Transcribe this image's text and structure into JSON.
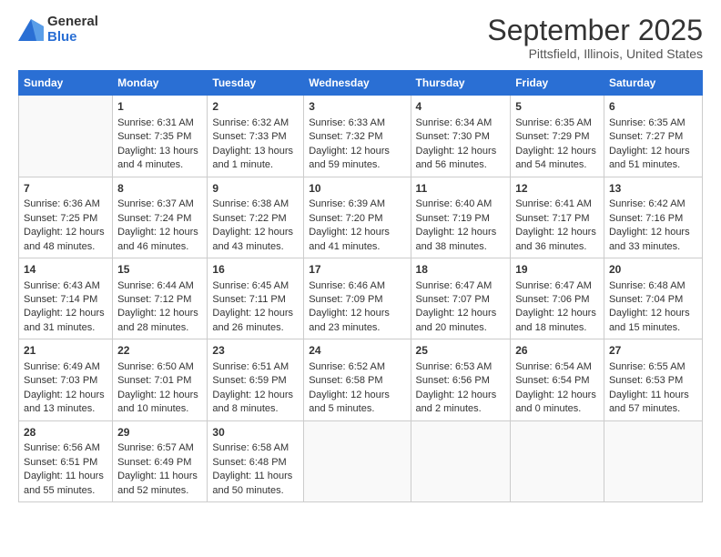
{
  "header": {
    "logo_general": "General",
    "logo_blue": "Blue",
    "title": "September 2025",
    "subtitle": "Pittsfield, Illinois, United States"
  },
  "columns": [
    "Sunday",
    "Monday",
    "Tuesday",
    "Wednesday",
    "Thursday",
    "Friday",
    "Saturday"
  ],
  "weeks": [
    [
      {
        "empty": true
      },
      {
        "day": 1,
        "sunrise": "6:31 AM",
        "sunset": "7:35 PM",
        "daylight": "13 hours and 4 minutes."
      },
      {
        "day": 2,
        "sunrise": "6:32 AM",
        "sunset": "7:33 PM",
        "daylight": "13 hours and 1 minute."
      },
      {
        "day": 3,
        "sunrise": "6:33 AM",
        "sunset": "7:32 PM",
        "daylight": "12 hours and 59 minutes."
      },
      {
        "day": 4,
        "sunrise": "6:34 AM",
        "sunset": "7:30 PM",
        "daylight": "12 hours and 56 minutes."
      },
      {
        "day": 5,
        "sunrise": "6:35 AM",
        "sunset": "7:29 PM",
        "daylight": "12 hours and 54 minutes."
      },
      {
        "day": 6,
        "sunrise": "6:35 AM",
        "sunset": "7:27 PM",
        "daylight": "12 hours and 51 minutes."
      }
    ],
    [
      {
        "day": 7,
        "sunrise": "6:36 AM",
        "sunset": "7:25 PM",
        "daylight": "12 hours and 48 minutes."
      },
      {
        "day": 8,
        "sunrise": "6:37 AM",
        "sunset": "7:24 PM",
        "daylight": "12 hours and 46 minutes."
      },
      {
        "day": 9,
        "sunrise": "6:38 AM",
        "sunset": "7:22 PM",
        "daylight": "12 hours and 43 minutes."
      },
      {
        "day": 10,
        "sunrise": "6:39 AM",
        "sunset": "7:20 PM",
        "daylight": "12 hours and 41 minutes."
      },
      {
        "day": 11,
        "sunrise": "6:40 AM",
        "sunset": "7:19 PM",
        "daylight": "12 hours and 38 minutes."
      },
      {
        "day": 12,
        "sunrise": "6:41 AM",
        "sunset": "7:17 PM",
        "daylight": "12 hours and 36 minutes."
      },
      {
        "day": 13,
        "sunrise": "6:42 AM",
        "sunset": "7:16 PM",
        "daylight": "12 hours and 33 minutes."
      }
    ],
    [
      {
        "day": 14,
        "sunrise": "6:43 AM",
        "sunset": "7:14 PM",
        "daylight": "12 hours and 31 minutes."
      },
      {
        "day": 15,
        "sunrise": "6:44 AM",
        "sunset": "7:12 PM",
        "daylight": "12 hours and 28 minutes."
      },
      {
        "day": 16,
        "sunrise": "6:45 AM",
        "sunset": "7:11 PM",
        "daylight": "12 hours and 26 minutes."
      },
      {
        "day": 17,
        "sunrise": "6:46 AM",
        "sunset": "7:09 PM",
        "daylight": "12 hours and 23 minutes."
      },
      {
        "day": 18,
        "sunrise": "6:47 AM",
        "sunset": "7:07 PM",
        "daylight": "12 hours and 20 minutes."
      },
      {
        "day": 19,
        "sunrise": "6:47 AM",
        "sunset": "7:06 PM",
        "daylight": "12 hours and 18 minutes."
      },
      {
        "day": 20,
        "sunrise": "6:48 AM",
        "sunset": "7:04 PM",
        "daylight": "12 hours and 15 minutes."
      }
    ],
    [
      {
        "day": 21,
        "sunrise": "6:49 AM",
        "sunset": "7:03 PM",
        "daylight": "12 hours and 13 minutes."
      },
      {
        "day": 22,
        "sunrise": "6:50 AM",
        "sunset": "7:01 PM",
        "daylight": "12 hours and 10 minutes."
      },
      {
        "day": 23,
        "sunrise": "6:51 AM",
        "sunset": "6:59 PM",
        "daylight": "12 hours and 8 minutes."
      },
      {
        "day": 24,
        "sunrise": "6:52 AM",
        "sunset": "6:58 PM",
        "daylight": "12 hours and 5 minutes."
      },
      {
        "day": 25,
        "sunrise": "6:53 AM",
        "sunset": "6:56 PM",
        "daylight": "12 hours and 2 minutes."
      },
      {
        "day": 26,
        "sunrise": "6:54 AM",
        "sunset": "6:54 PM",
        "daylight": "12 hours and 0 minutes."
      },
      {
        "day": 27,
        "sunrise": "6:55 AM",
        "sunset": "6:53 PM",
        "daylight": "11 hours and 57 minutes."
      }
    ],
    [
      {
        "day": 28,
        "sunrise": "6:56 AM",
        "sunset": "6:51 PM",
        "daylight": "11 hours and 55 minutes."
      },
      {
        "day": 29,
        "sunrise": "6:57 AM",
        "sunset": "6:49 PM",
        "daylight": "11 hours and 52 minutes."
      },
      {
        "day": 30,
        "sunrise": "6:58 AM",
        "sunset": "6:48 PM",
        "daylight": "11 hours and 50 minutes."
      },
      {
        "empty": true
      },
      {
        "empty": true
      },
      {
        "empty": true
      },
      {
        "empty": true
      }
    ]
  ]
}
